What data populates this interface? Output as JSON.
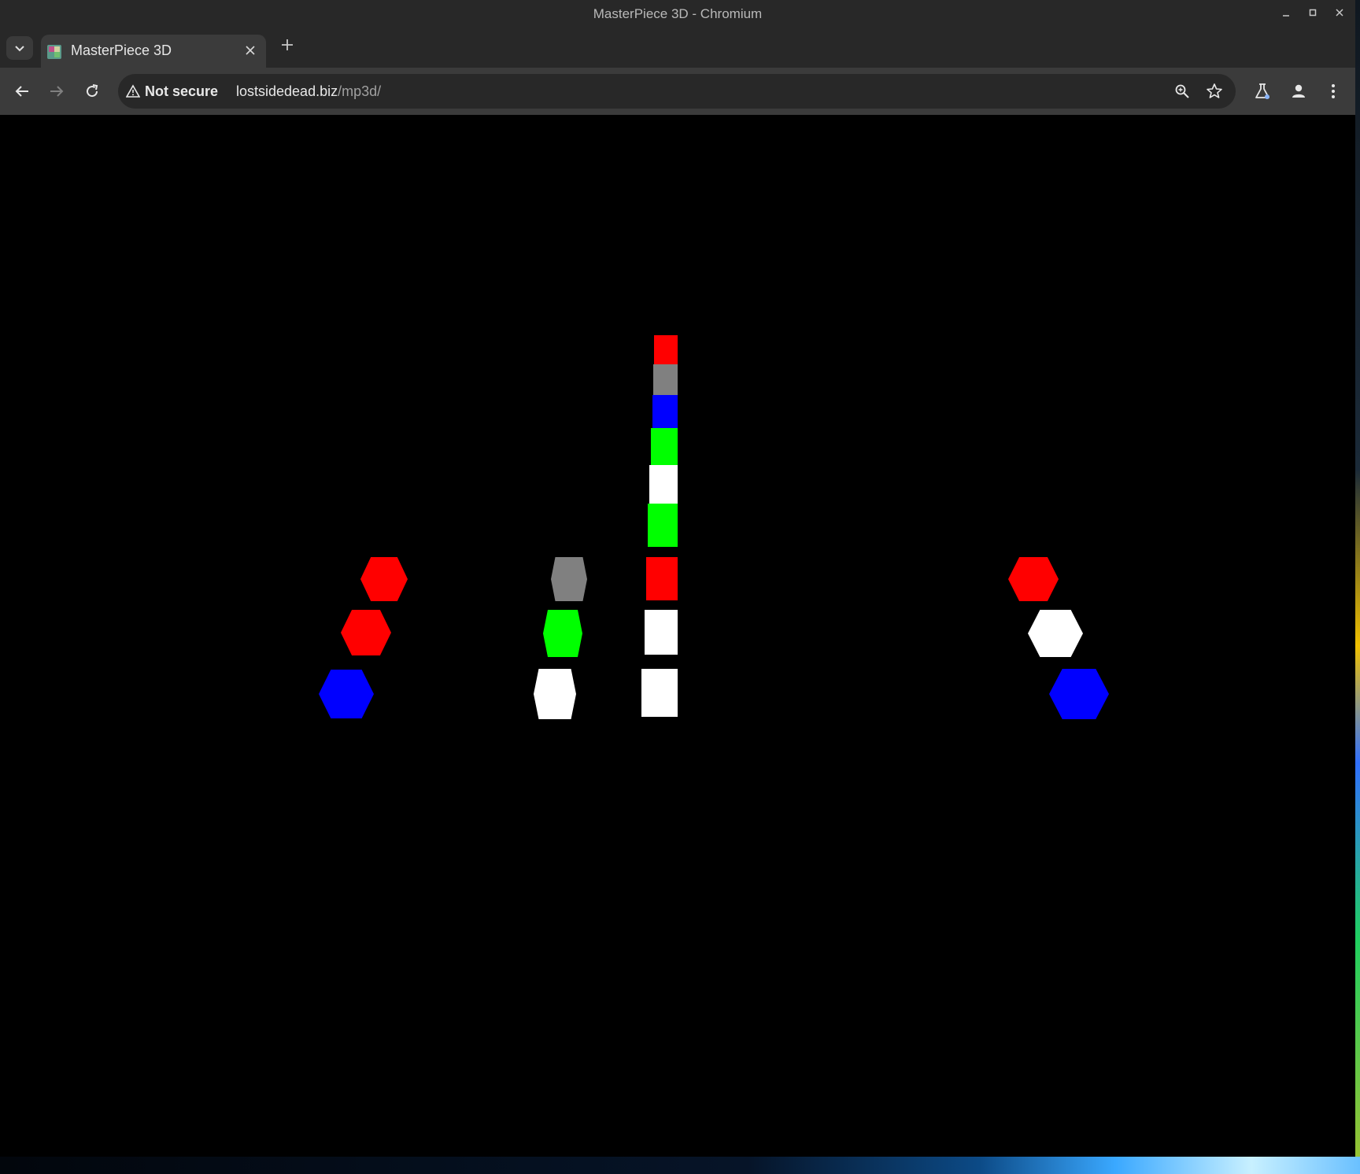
{
  "window": {
    "title": "MasterPiece 3D - Chromium",
    "controls": [
      "minimize",
      "maximize",
      "close"
    ]
  },
  "tabs": [
    {
      "title": "MasterPiece 3D",
      "active": true,
      "favicon": "masterpiece-favicon"
    }
  ],
  "address_bar": {
    "security_label": "Not secure",
    "url_host": "lostsidedead.biz",
    "url_path": "/mp3d/"
  },
  "toolbar": {
    "icons": [
      "back-arrow-icon",
      "forward-arrow-icon",
      "reload-icon",
      "warning-icon",
      "zoom-icon",
      "bookmark-star-icon",
      "labs-flask-icon",
      "profile-icon",
      "menu-icon"
    ]
  },
  "scene": {
    "background": "#000000",
    "colors": {
      "red": "#ff0000",
      "gray": "#808080",
      "blue": "#0000ff",
      "green": "#00ff00",
      "white": "#ffffff"
    },
    "center_column_top_to_bottom": [
      "red",
      "gray",
      "blue",
      "green",
      "white",
      "green",
      "red",
      "white",
      "white"
    ],
    "left_outer_column_top_to_bottom": [
      "red",
      "red",
      "blue"
    ],
    "left_inner_column_top_to_bottom": [
      "gray",
      "green",
      "white"
    ],
    "right_column_top_to_bottom": [
      "red",
      "white",
      "blue"
    ]
  }
}
